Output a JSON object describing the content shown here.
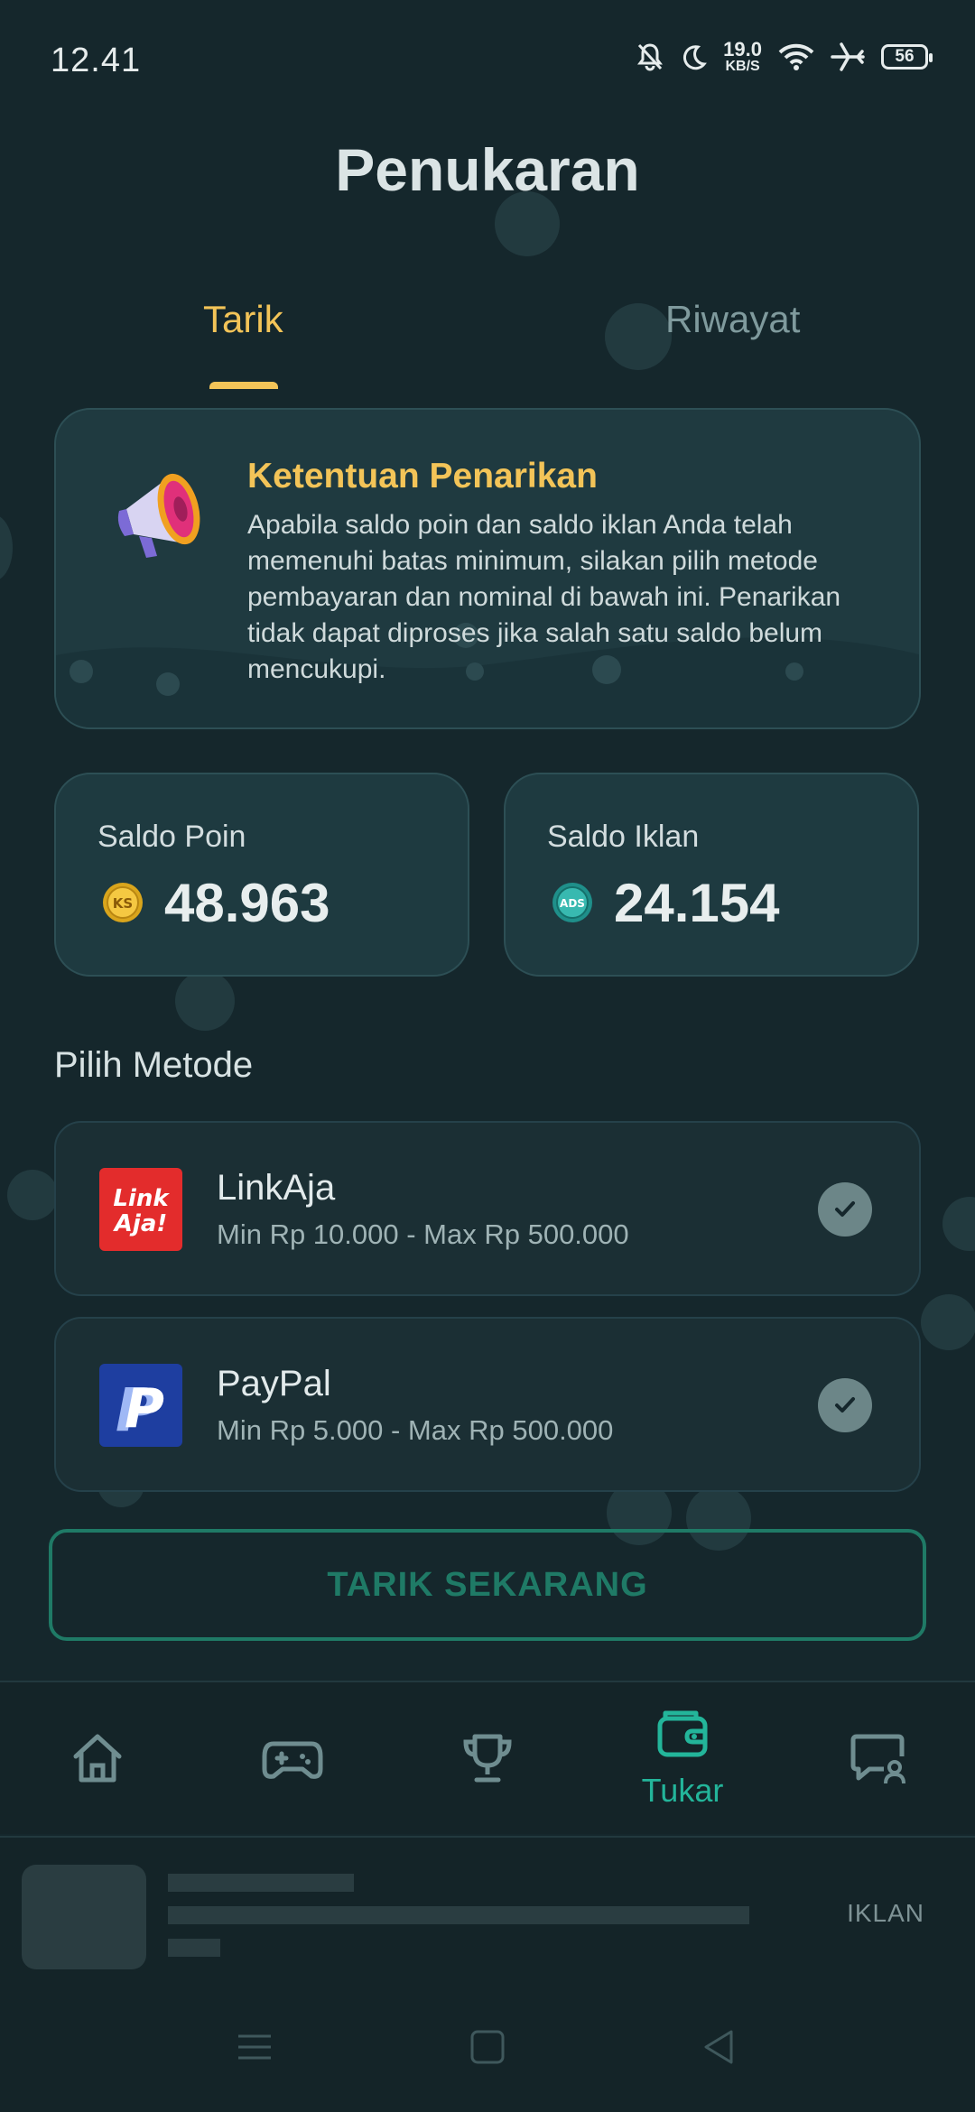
{
  "status_bar": {
    "time": "12.41",
    "net_speed_value": "19.0",
    "net_speed_unit": "KB/S",
    "battery": "56",
    "icons": [
      "bell-off-icon",
      "moon-icon",
      "wifi-icon",
      "airplane-icon",
      "battery-icon"
    ]
  },
  "page": {
    "title": "Penukaran"
  },
  "tabs": [
    {
      "label": "Tarik",
      "active": true
    },
    {
      "label": "Riwayat",
      "active": false
    }
  ],
  "notice": {
    "title": "Ketentuan Penarikan",
    "text": "Apabila saldo poin dan saldo iklan Anda telah memenuhi batas minimum, silakan pilih metode pembayaran dan nominal di bawah ini. Penarikan tidak dapat diproses jika salah satu saldo belum mencukupi.",
    "icon": "megaphone-icon"
  },
  "balances": {
    "points": {
      "label": "Saldo Poin",
      "value": "48.963",
      "coin": "KS"
    },
    "ads": {
      "label": "Saldo Iklan",
      "value": "24.154",
      "coin": "ADS"
    }
  },
  "methods": {
    "section_title": "Pilih Metode",
    "items": [
      {
        "name": "LinkAja",
        "range": "Min Rp 10.000 - Max Rp 500.000",
        "logo_text_1": "Link",
        "logo_text_2": "Aja!"
      },
      {
        "name": "PayPal",
        "range": "Min Rp 5.000 - Max Rp 500.000",
        "logo_text": "P"
      }
    ]
  },
  "cta": {
    "label": "TARIK SEKARANG"
  },
  "bottom_nav": {
    "items": [
      {
        "icon": "home-icon"
      },
      {
        "icon": "gamepad-icon"
      },
      {
        "icon": "trophy-icon"
      },
      {
        "icon": "wallet-icon",
        "label": "Tukar",
        "active": true
      },
      {
        "icon": "chat-user-icon"
      }
    ]
  },
  "ad": {
    "label": "IKLAN"
  },
  "colors": {
    "background": "#15272c",
    "accent_yellow": "#f3c458",
    "accent_green": "#23b59a",
    "cta_border": "#1f7a66"
  }
}
